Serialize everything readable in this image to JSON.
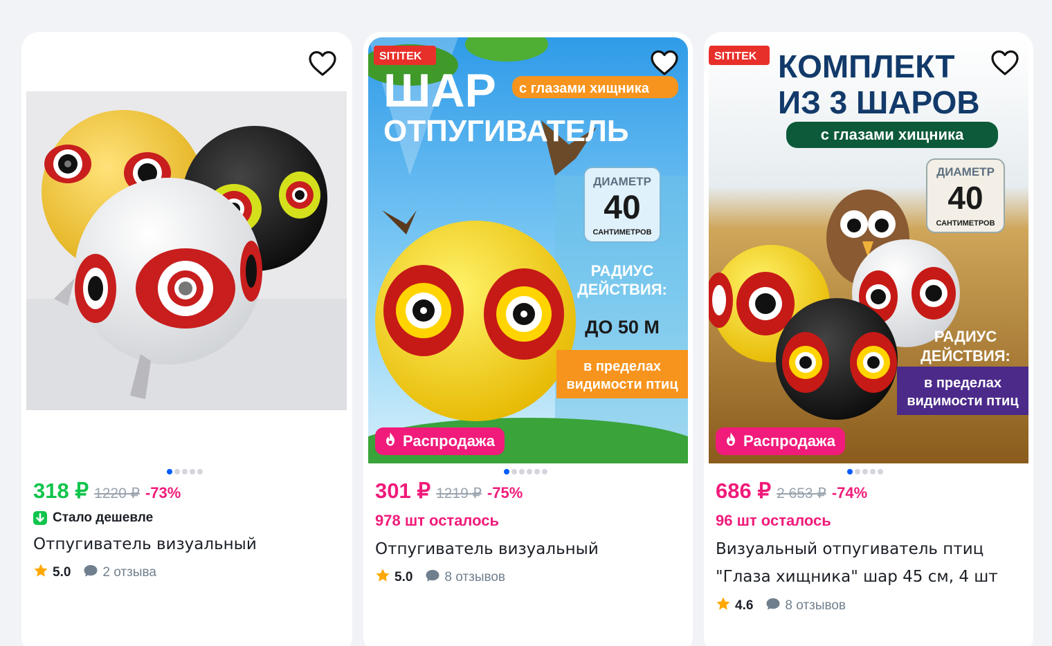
{
  "products": [
    {
      "price": "318 ₽",
      "old_price": "1220 ₽",
      "discount": "-73%",
      "cheaper_label": "Стало дешевле",
      "title": "Отпугиватель визуальный",
      "rating": "5.0",
      "reviews": "2 отзыва",
      "price_color": "#10c44c",
      "dots": 5,
      "active_dot": 0
    },
    {
      "price": "301 ₽",
      "old_price": "1219 ₽",
      "discount": "-75%",
      "stock": "978 шт осталось",
      "badge": "Распродажа",
      "title": "Отпугиватель визуальный",
      "rating": "5.0",
      "reviews": "8 отзывов",
      "price_color": "#f01b7a",
      "dots": 6,
      "active_dot": 0,
      "image_text": {
        "brand": "SITITEK",
        "line1": "ШАР",
        "tag": "с глазами хищника",
        "line2": "ОТПУГИВАТЕЛЬ",
        "diam_label": "ДИАМЕТР",
        "diam_value": "40",
        "diam_unit": "САНТИМЕТРОВ",
        "radius_1": "РАДИУС",
        "radius_2": "ДЕЙСТВИЯ:",
        "radius_val": "ДО 50 М",
        "vis_1": "в пределах",
        "vis_2": "видимости птиц"
      }
    },
    {
      "price": "686 ₽",
      "old_price": "2 653 ₽",
      "discount": "-74%",
      "stock": "96 шт осталось",
      "badge": "Распродажа",
      "title": "Визуальный отпугиватель птиц \"Глаза хищника\" шар 45 см, 4 шт",
      "rating": "4.6",
      "reviews": "8 отзывов",
      "price_color": "#f01b7a",
      "dots": 5,
      "active_dot": 0,
      "image_text": {
        "brand": "SITITEK",
        "line1": "КОМПЛЕКТ",
        "line2": "ИЗ 3 ШАРОВ",
        "tag": "с глазами хищника",
        "diam_label": "ДИАМЕТР",
        "diam_value": "40",
        "diam_unit": "САНТИМЕТРОВ",
        "radius_1": "РАДИУС",
        "radius_2": "ДЕЙСТВИЯ:",
        "vis_1": "в пределах",
        "vis_2": "видимости птиц"
      }
    }
  ]
}
